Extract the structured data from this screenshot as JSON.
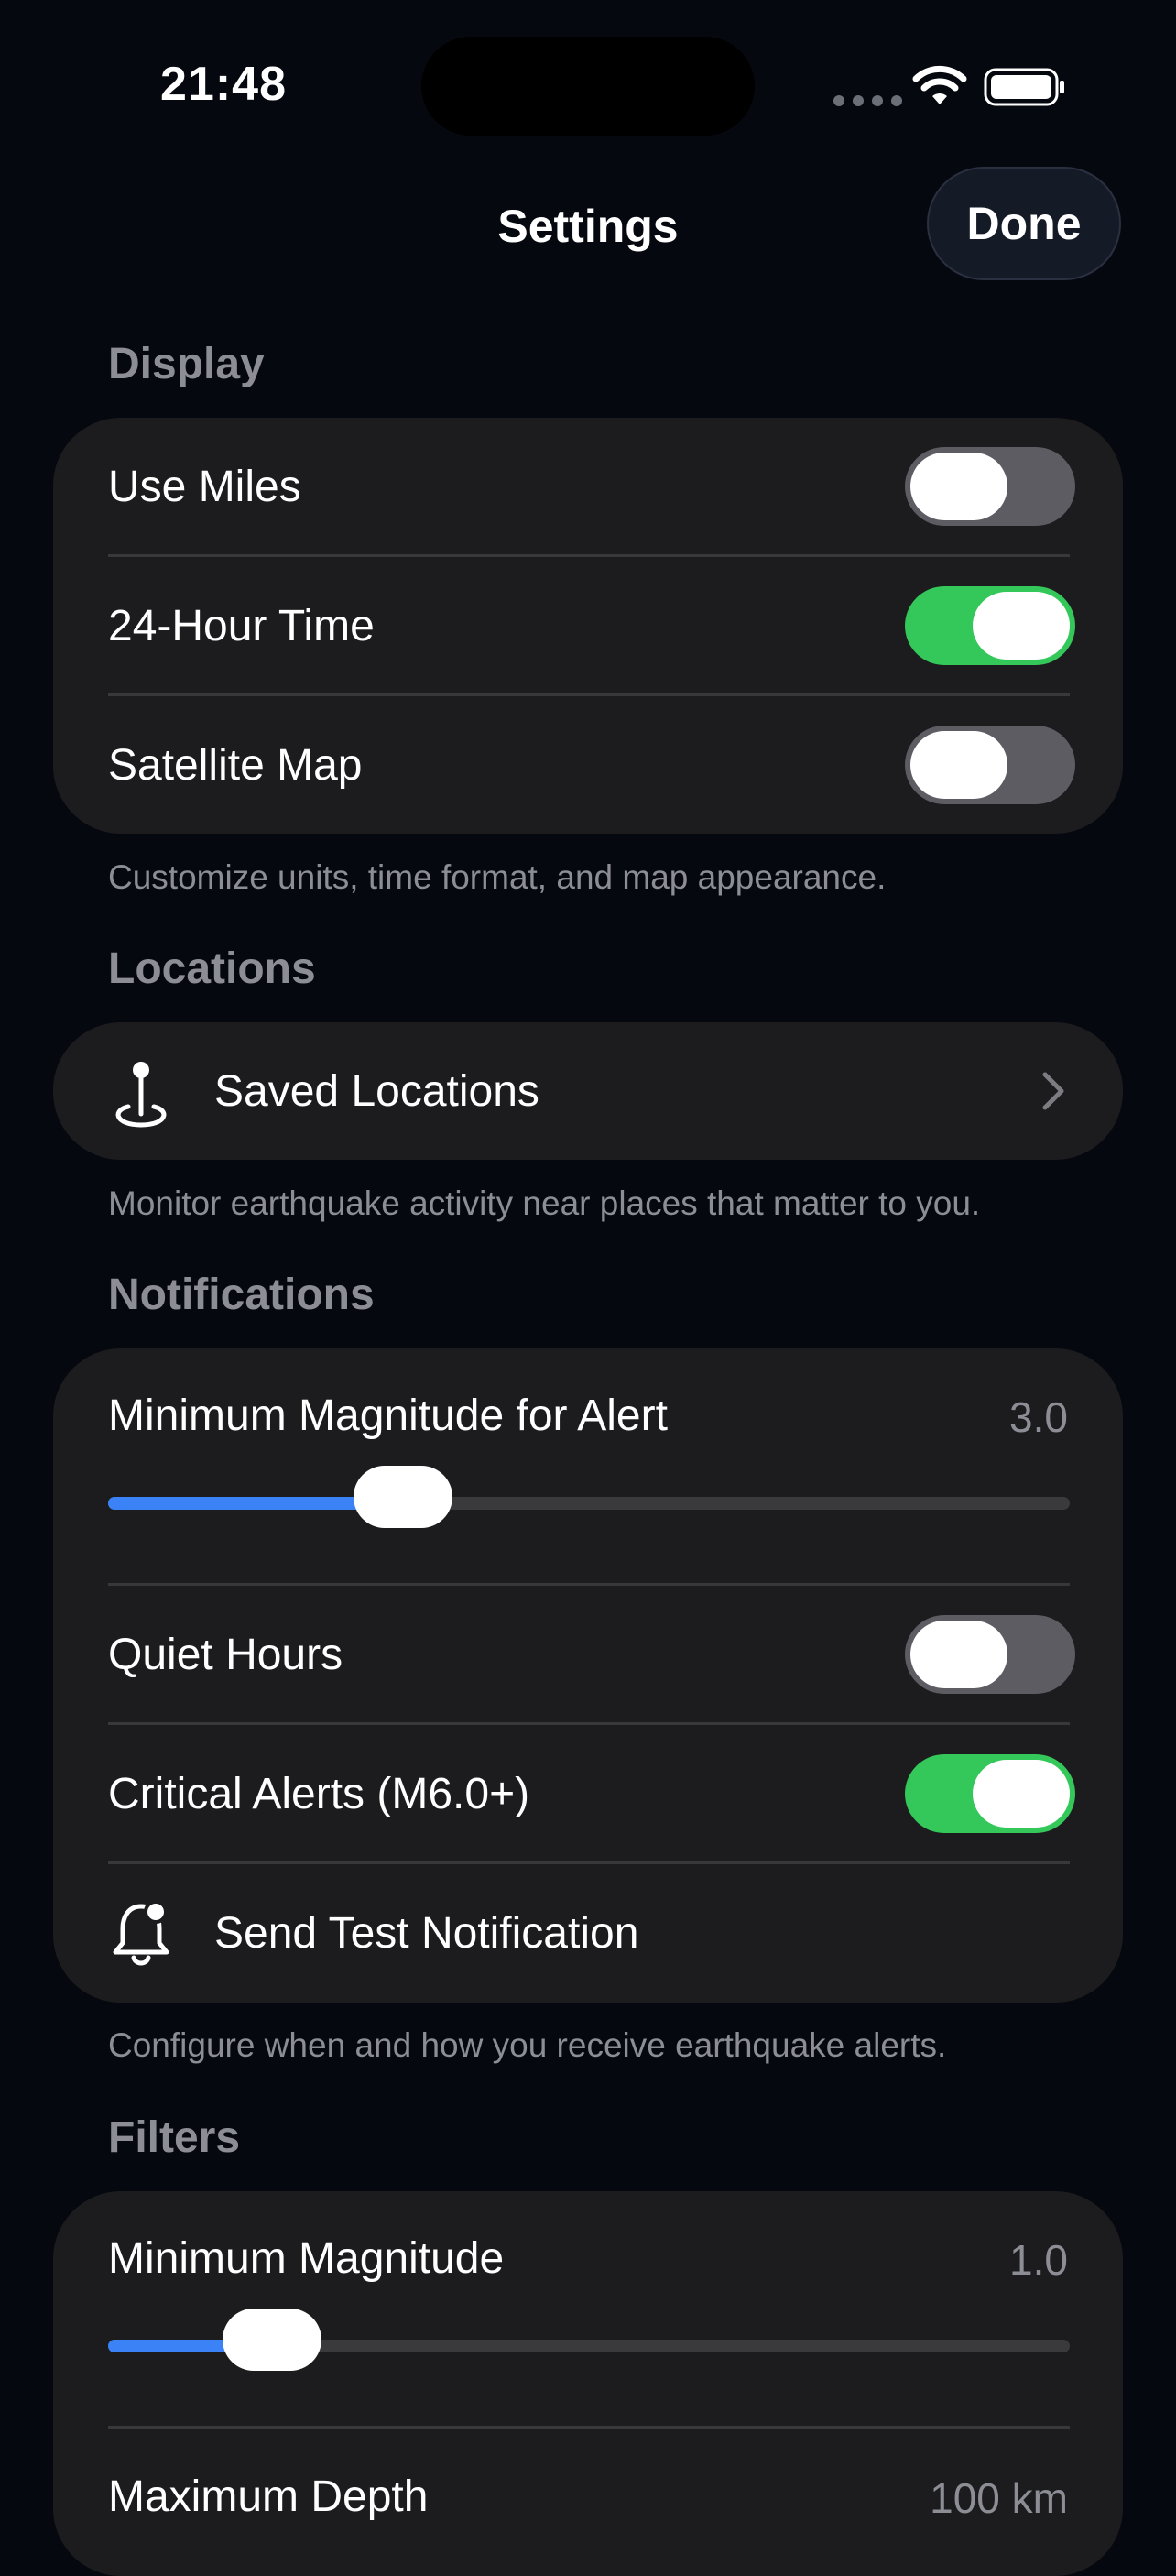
{
  "status_bar": {
    "time": "21:48"
  },
  "nav": {
    "title": "Settings",
    "done_label": "Done"
  },
  "display": {
    "header": "Display",
    "items": [
      {
        "label": "Use Miles",
        "on": false
      },
      {
        "label": "24-Hour Time",
        "on": true
      },
      {
        "label": "Satellite Map",
        "on": false
      }
    ],
    "footer": "Customize units, time format, and map appearance."
  },
  "locations": {
    "header": "Locations",
    "saved_label": "Saved Locations",
    "icon": "location-pin-icon",
    "footer": "Monitor earthquake activity near places that matter to you."
  },
  "notifications": {
    "header": "Notifications",
    "min_magnitude_label": "Minimum Magnitude for Alert",
    "min_magnitude_value": "3.0",
    "min_magnitude_fraction": 0.307,
    "quiet_hours_label": "Quiet Hours",
    "quiet_hours_on": false,
    "critical_label": "Critical Alerts (M6.0+)",
    "critical_on": true,
    "test_label": "Send Test Notification",
    "test_icon": "bell-badge-icon",
    "footer": "Configure when and how you receive earthquake alerts."
  },
  "filters": {
    "header": "Filters",
    "min_magnitude_label": "Minimum Magnitude",
    "min_magnitude_value": "1.0",
    "min_magnitude_fraction": 0.17,
    "max_depth_label": "Maximum Depth",
    "max_depth_value": "100 km"
  },
  "colors": {
    "accent": "#3b82f6",
    "toggle_on": "#34c759",
    "card": "#1c1c1e",
    "background": "#05080f"
  }
}
